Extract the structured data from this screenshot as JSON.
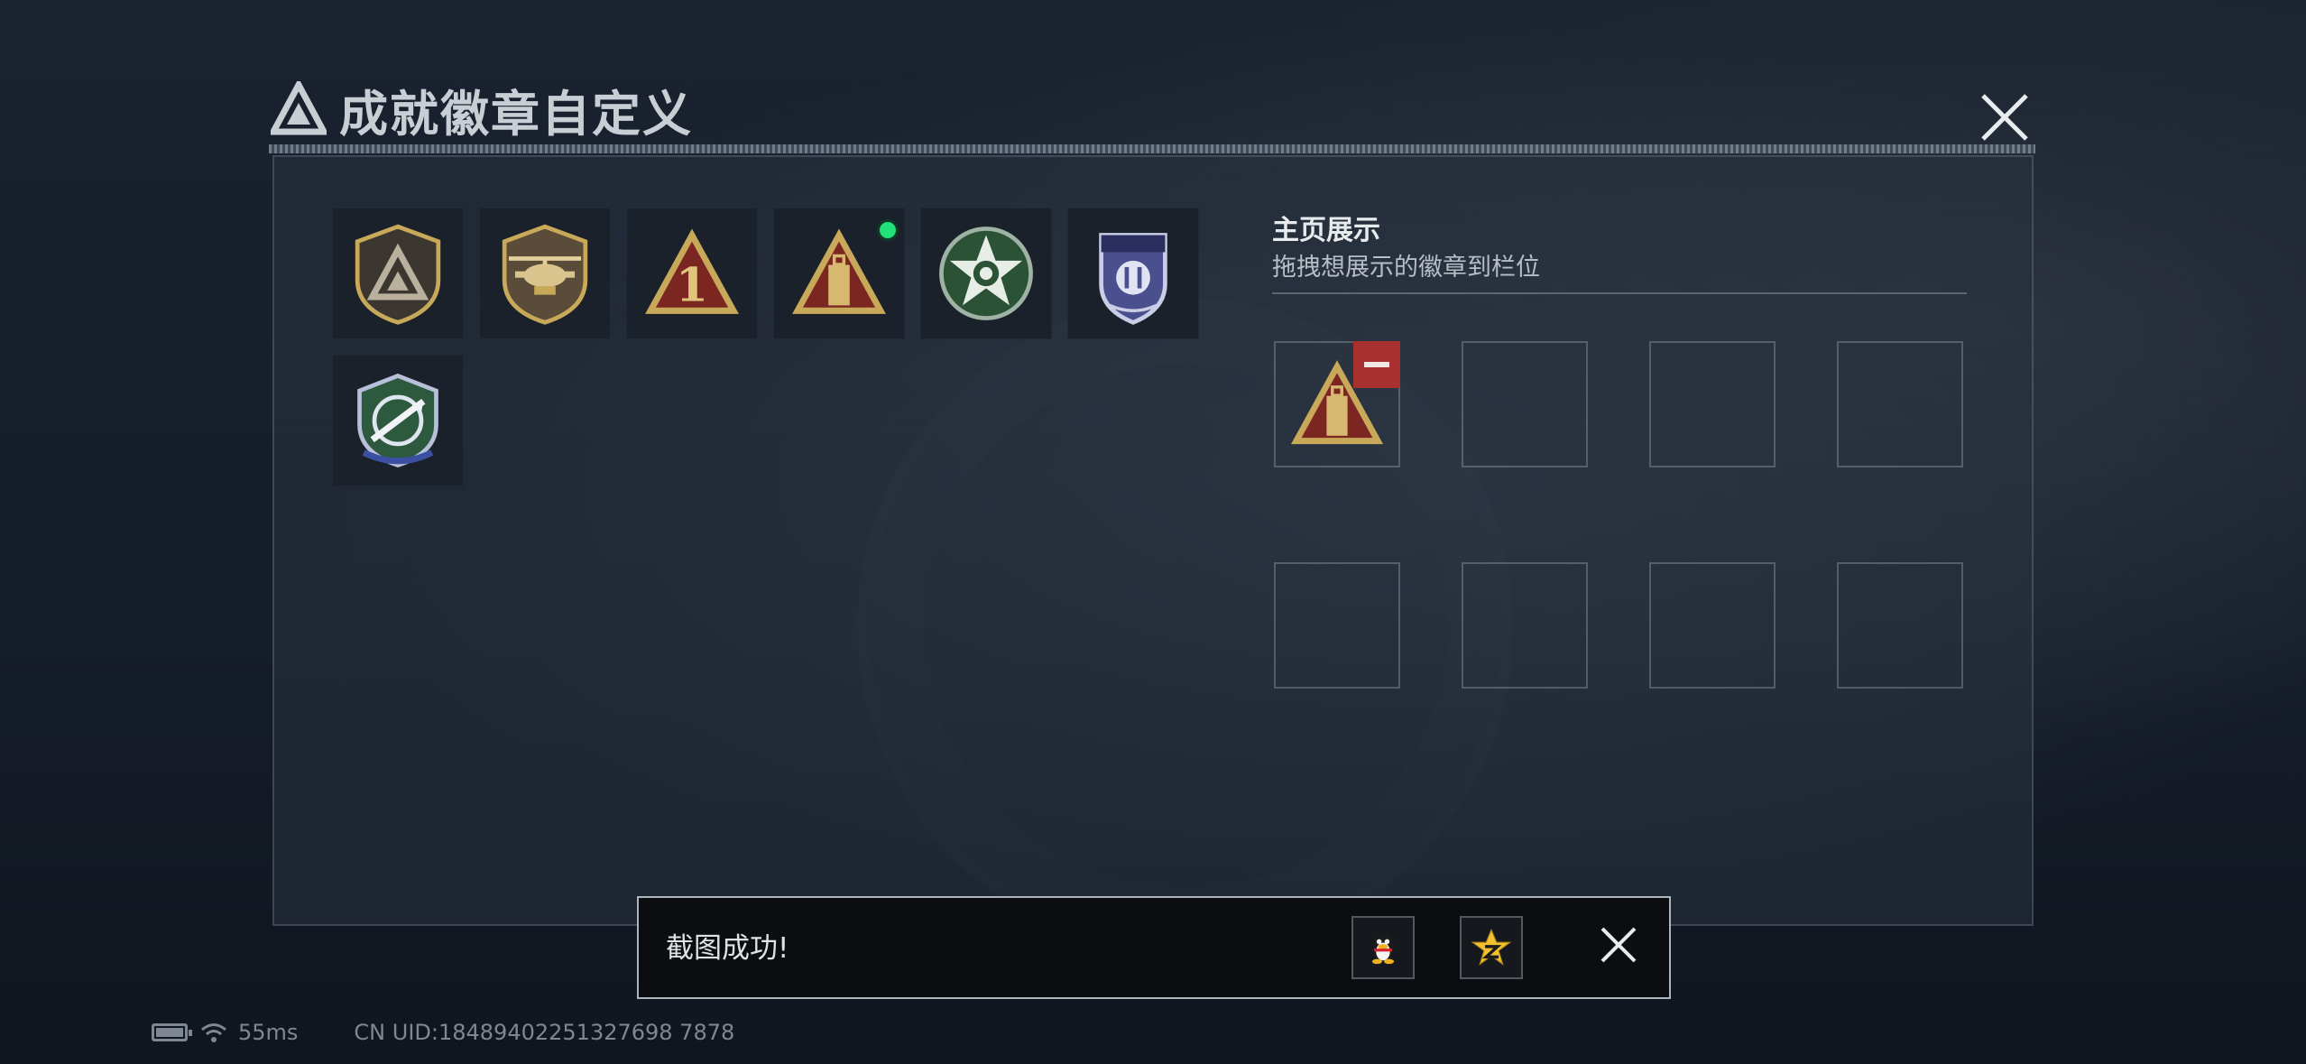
{
  "header": {
    "title": "成就徽章自定义",
    "close_icon": "close-icon"
  },
  "badges": [
    {
      "id": "badge-1",
      "icon": "triangle-shield-badge",
      "new": false
    },
    {
      "id": "badge-2",
      "icon": "helicopter-badge",
      "new": false
    },
    {
      "id": "badge-3",
      "icon": "number-one-triangle-badge",
      "new": false
    },
    {
      "id": "badge-4",
      "icon": "tower-triangle-badge",
      "new": true
    },
    {
      "id": "badge-5",
      "icon": "green-star-badge",
      "new": false
    },
    {
      "id": "badge-6",
      "icon": "blue-police-badge",
      "new": false
    },
    {
      "id": "badge-7",
      "icon": "green-missile-shield-badge",
      "new": false
    }
  ],
  "display": {
    "title": "主页展示",
    "subtitle": "拖拽想展示的徽章到栏位",
    "slots": [
      {
        "filled": true,
        "icon": "tower-triangle-badge"
      },
      {
        "filled": false
      },
      {
        "filled": false
      },
      {
        "filled": false
      },
      {
        "filled": false
      },
      {
        "filled": false
      },
      {
        "filled": false
      },
      {
        "filled": false
      }
    ]
  },
  "toast": {
    "message": "截图成功!",
    "share_qq_icon": "qq-penguin-icon",
    "share_qzone_icon": "qzone-star-icon",
    "close_icon": "close-icon"
  },
  "status_bar": {
    "latency": "55ms",
    "uid": "CN UID:18489402251327698 7878"
  },
  "colors": {
    "accent_gold": "#c8a95a",
    "new_dot": "#22e07a",
    "remove_red": "#a8312f"
  }
}
